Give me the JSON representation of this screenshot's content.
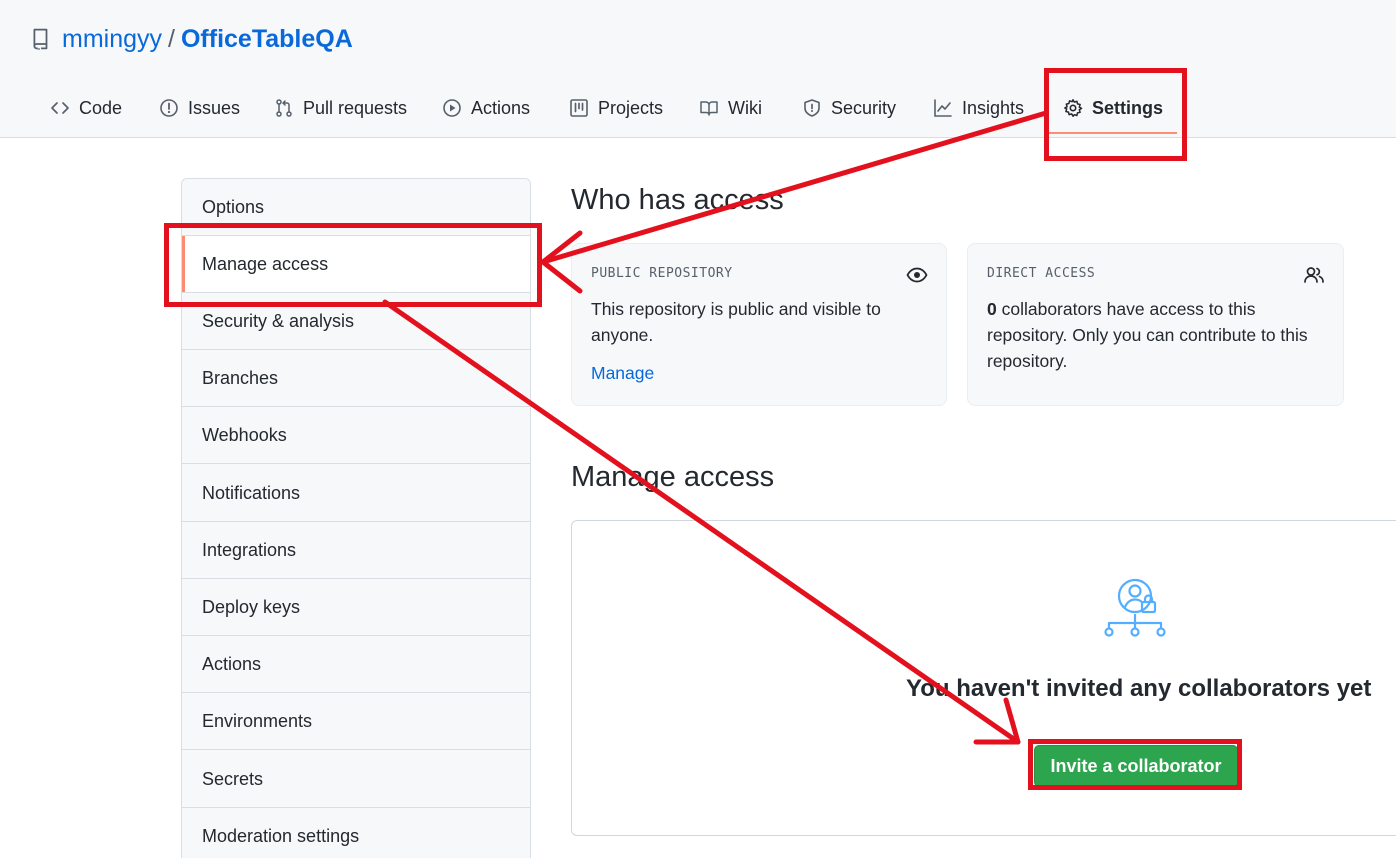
{
  "repo": {
    "owner": "mmingyy",
    "separator": "/",
    "name": "OfficeTableQA"
  },
  "tabs": [
    {
      "label": "Code",
      "icon": "code-icon"
    },
    {
      "label": "Issues",
      "icon": "issue-icon"
    },
    {
      "label": "Pull requests",
      "icon": "pull-request-icon"
    },
    {
      "label": "Actions",
      "icon": "play-icon"
    },
    {
      "label": "Projects",
      "icon": "project-icon"
    },
    {
      "label": "Wiki",
      "icon": "book-icon"
    },
    {
      "label": "Security",
      "icon": "shield-icon"
    },
    {
      "label": "Insights",
      "icon": "graph-icon"
    },
    {
      "label": "Settings",
      "icon": "gear-icon",
      "selected": true
    }
  ],
  "sidebar": {
    "items": [
      {
        "label": "Options"
      },
      {
        "label": "Manage access",
        "selected": true
      },
      {
        "label": "Security & analysis"
      },
      {
        "label": "Branches"
      },
      {
        "label": "Webhooks"
      },
      {
        "label": "Notifications"
      },
      {
        "label": "Integrations"
      },
      {
        "label": "Deploy keys"
      },
      {
        "label": "Actions"
      },
      {
        "label": "Environments"
      },
      {
        "label": "Secrets"
      },
      {
        "label": "Moderation settings"
      }
    ]
  },
  "who_has_access": {
    "title": "Who has access",
    "public_card": {
      "label": "PUBLIC REPOSITORY",
      "icon": "eye-icon",
      "text_line1": "This repository is public and visible to",
      "text_line2": "anyone.",
      "link": "Manage"
    },
    "direct_card": {
      "label": "DIRECT ACCESS",
      "icon": "people-icon",
      "count": "0",
      "text_line1_rest": " collaborators have access to this",
      "text_line2": "repository. Only you can contribute to this",
      "text_line3": "repository."
    }
  },
  "manage_access": {
    "title": "Manage access",
    "illustration_icon": "person-lock-icon",
    "empty_title": "You haven't invited any collaborators yet",
    "invite_button": "Invite a collaborator"
  },
  "colors": {
    "link": "#0969da",
    "accent_underline": "#fd8c73",
    "primary_button": "#2da44e",
    "annotation": "#e3111d",
    "illustration": "#54aeff"
  }
}
